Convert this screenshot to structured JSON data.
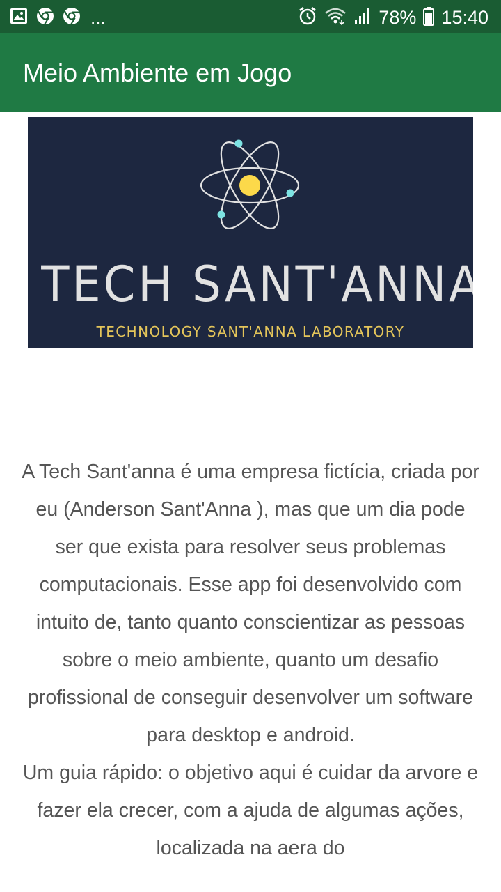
{
  "status_bar": {
    "left_icons": [
      "image-icon",
      "chrome-icon",
      "chrome-icon",
      "more-dots"
    ],
    "more": "...",
    "right_icons": [
      "alarm-icon",
      "wifi-icon",
      "signal-icon",
      "battery-icon"
    ],
    "battery": "78%",
    "time": "15:40"
  },
  "app_bar": {
    "title": "Meio Ambiente em Jogo",
    "color": "#1f7a44"
  },
  "logo": {
    "name": "TECH SANT'ANNA",
    "subtitle": "TECHNOLOGY SANT'ANNA LABORATORY",
    "background": "#1d2740",
    "accent_nucleus": "#fcd94a",
    "accent_electron": "#7de3e3"
  },
  "content": {
    "paragraph1": "A Tech Sant'anna é uma empresa fictícia, criada por eu (Anderson Sant'Anna ), mas que um dia pode ser que exista para resolver seus problemas computacionais. Esse app foi desenvolvido com intuito de, tanto quanto conscientizar as pessoas sobre o meio ambiente, quanto um desafio profissional de conseguir desenvolver um software para desktop e android.",
    "paragraph2": "Um guia rápido: o objetivo aqui é cuidar da arvore e fazer ela crecer, com a ajuda de algumas ações, localizada na aera do"
  }
}
